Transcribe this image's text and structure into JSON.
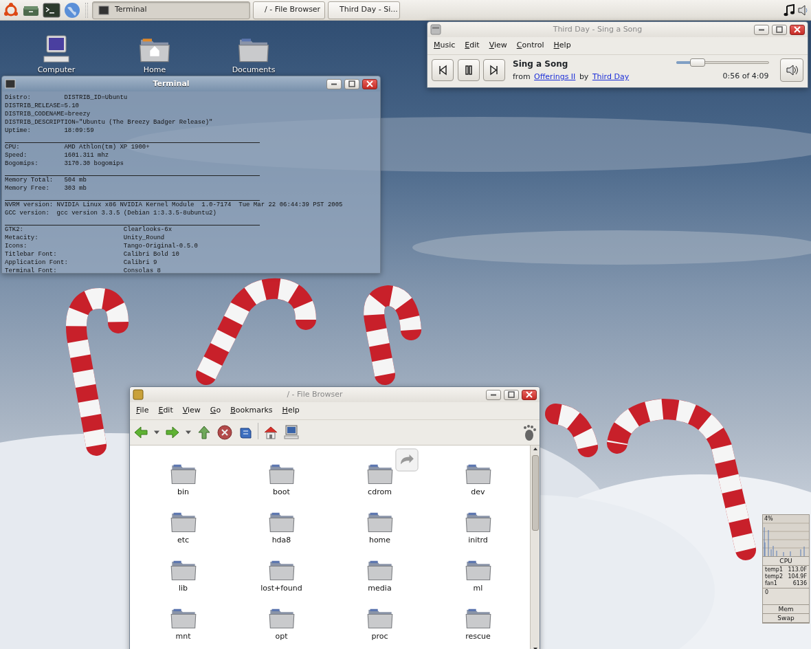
{
  "panel": {
    "tasks": [
      {
        "label": "Terminal",
        "kind": "terminal",
        "selected": true
      },
      {
        "label": "/ - File Browser",
        "kind": "files",
        "selected": false
      },
      {
        "label": "Third Day - Si...",
        "kind": "player",
        "selected": false
      }
    ]
  },
  "desktop_icons": [
    {
      "label": "Computer",
      "kind": "computer"
    },
    {
      "label": "Home",
      "kind": "home"
    },
    {
      "label": "Documents",
      "kind": "folder"
    }
  ],
  "terminal": {
    "title": "Terminal",
    "lines": [
      {
        "kind": "text",
        "text": "Distro:         DISTRIB_ID=Ubuntu"
      },
      {
        "kind": "text",
        "text": "DISTRIB_RELEASE=5.10"
      },
      {
        "kind": "text",
        "text": "DISTRIB_CODENAME=breezy"
      },
      {
        "kind": "text",
        "text": "DISTRIB_DESCRIPTION=\"Ubuntu (The Breezy Badger Release)\""
      },
      {
        "kind": "text",
        "text": "Uptime:         18:09:59"
      },
      {
        "kind": "rule"
      },
      {
        "kind": "text",
        "text": "CPU:            AMD Athlon(tm) XP 1900+"
      },
      {
        "kind": "text",
        "text": "Speed:          1601.311 mhz"
      },
      {
        "kind": "text",
        "text": "Bogomips:       3170.30 bogomips"
      },
      {
        "kind": "rule"
      },
      {
        "kind": "text",
        "text": "Memory Total:   504 mb"
      },
      {
        "kind": "text",
        "text": "Memory Free:    303 mb"
      },
      {
        "kind": "rule"
      },
      {
        "kind": "text",
        "text": "NVRM version: NVIDIA Linux x86 NVIDIA Kernel Module  1.0-7174  Tue Mar 22 06:44:39 PST 2005"
      },
      {
        "kind": "text",
        "text": "GCC version:  gcc version 3.3.5 (Debian 1:3.3.5-8ubuntu2)"
      },
      {
        "kind": "rule"
      },
      {
        "kind": "text",
        "text": "GTK2:                           Clearlooks-6x"
      },
      {
        "kind": "text",
        "text": "Metacity:                       Unity_Round"
      },
      {
        "kind": "text",
        "text": "Icons:                          Tango-Original-0.5.0"
      },
      {
        "kind": "text",
        "text": "Titlebar Font:                  Calibri Bold 10"
      },
      {
        "kind": "text",
        "text": "Application Font:               Calibri 9"
      },
      {
        "kind": "text",
        "text": "Terminal Font:                  Consolas 8"
      }
    ]
  },
  "player": {
    "title": "Third Day - Sing a Song",
    "menu": [
      "Music",
      "Edit",
      "View",
      "Control",
      "Help"
    ],
    "song": "Sing a Song",
    "from_label": "from",
    "album": "Offerings II",
    "by_label": "by",
    "artist": "Third Day",
    "level": 0.23,
    "time": "0:56 of 4:09"
  },
  "file_browser": {
    "title": "/ - File Browser",
    "menu": [
      "File",
      "Edit",
      "View",
      "Go",
      "Bookmarks",
      "Help"
    ],
    "files": [
      {
        "name": "bin",
        "symlink": false
      },
      {
        "name": "boot",
        "symlink": false
      },
      {
        "name": "cdrom",
        "symlink": true
      },
      {
        "name": "dev",
        "symlink": false
      },
      {
        "name": "etc",
        "symlink": false
      },
      {
        "name": "hda8",
        "symlink": false
      },
      {
        "name": "home",
        "symlink": false
      },
      {
        "name": "initrd",
        "symlink": false
      },
      {
        "name": "lib",
        "symlink": false
      },
      {
        "name": "lost+found",
        "symlink": false
      },
      {
        "name": "media",
        "symlink": false
      },
      {
        "name": "ml",
        "symlink": false
      },
      {
        "name": "mnt",
        "symlink": false
      },
      {
        "name": "opt",
        "symlink": false
      },
      {
        "name": "proc",
        "symlink": false
      },
      {
        "name": "rescue",
        "symlink": false
      }
    ]
  },
  "monitor": {
    "cpu_reading": "4%",
    "cpu_label": "CPU",
    "sensors": [
      {
        "name": "temp1",
        "value": "113.0F"
      },
      {
        "name": "temp2",
        "value": "104.9F"
      },
      {
        "name": "fan1",
        "value": "6136"
      }
    ],
    "mem_reading": "0",
    "mem_label": "Mem",
    "swap_label": "Swap"
  }
}
